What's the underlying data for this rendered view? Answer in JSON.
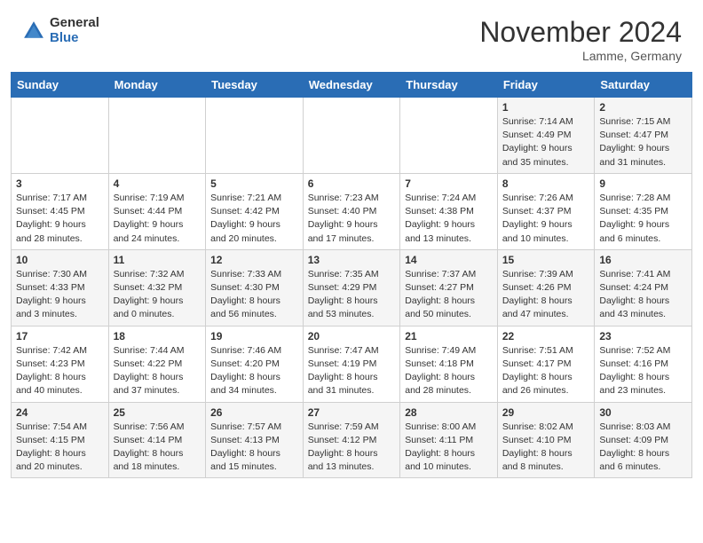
{
  "header": {
    "logo": {
      "general": "General",
      "blue": "Blue"
    },
    "title": "November 2024",
    "subtitle": "Lamme, Germany"
  },
  "calendar": {
    "days": [
      "Sunday",
      "Monday",
      "Tuesday",
      "Wednesday",
      "Thursday",
      "Friday",
      "Saturday"
    ],
    "weeks": [
      [
        {
          "day": "",
          "info": ""
        },
        {
          "day": "",
          "info": ""
        },
        {
          "day": "",
          "info": ""
        },
        {
          "day": "",
          "info": ""
        },
        {
          "day": "",
          "info": ""
        },
        {
          "day": "1",
          "info": "Sunrise: 7:14 AM\nSunset: 4:49 PM\nDaylight: 9 hours\nand 35 minutes."
        },
        {
          "day": "2",
          "info": "Sunrise: 7:15 AM\nSunset: 4:47 PM\nDaylight: 9 hours\nand 31 minutes."
        }
      ],
      [
        {
          "day": "3",
          "info": "Sunrise: 7:17 AM\nSunset: 4:45 PM\nDaylight: 9 hours\nand 28 minutes."
        },
        {
          "day": "4",
          "info": "Sunrise: 7:19 AM\nSunset: 4:44 PM\nDaylight: 9 hours\nand 24 minutes."
        },
        {
          "day": "5",
          "info": "Sunrise: 7:21 AM\nSunset: 4:42 PM\nDaylight: 9 hours\nand 20 minutes."
        },
        {
          "day": "6",
          "info": "Sunrise: 7:23 AM\nSunset: 4:40 PM\nDaylight: 9 hours\nand 17 minutes."
        },
        {
          "day": "7",
          "info": "Sunrise: 7:24 AM\nSunset: 4:38 PM\nDaylight: 9 hours\nand 13 minutes."
        },
        {
          "day": "8",
          "info": "Sunrise: 7:26 AM\nSunset: 4:37 PM\nDaylight: 9 hours\nand 10 minutes."
        },
        {
          "day": "9",
          "info": "Sunrise: 7:28 AM\nSunset: 4:35 PM\nDaylight: 9 hours\nand 6 minutes."
        }
      ],
      [
        {
          "day": "10",
          "info": "Sunrise: 7:30 AM\nSunset: 4:33 PM\nDaylight: 9 hours\nand 3 minutes."
        },
        {
          "day": "11",
          "info": "Sunrise: 7:32 AM\nSunset: 4:32 PM\nDaylight: 9 hours\nand 0 minutes."
        },
        {
          "day": "12",
          "info": "Sunrise: 7:33 AM\nSunset: 4:30 PM\nDaylight: 8 hours\nand 56 minutes."
        },
        {
          "day": "13",
          "info": "Sunrise: 7:35 AM\nSunset: 4:29 PM\nDaylight: 8 hours\nand 53 minutes."
        },
        {
          "day": "14",
          "info": "Sunrise: 7:37 AM\nSunset: 4:27 PM\nDaylight: 8 hours\nand 50 minutes."
        },
        {
          "day": "15",
          "info": "Sunrise: 7:39 AM\nSunset: 4:26 PM\nDaylight: 8 hours\nand 47 minutes."
        },
        {
          "day": "16",
          "info": "Sunrise: 7:41 AM\nSunset: 4:24 PM\nDaylight: 8 hours\nand 43 minutes."
        }
      ],
      [
        {
          "day": "17",
          "info": "Sunrise: 7:42 AM\nSunset: 4:23 PM\nDaylight: 8 hours\nand 40 minutes."
        },
        {
          "day": "18",
          "info": "Sunrise: 7:44 AM\nSunset: 4:22 PM\nDaylight: 8 hours\nand 37 minutes."
        },
        {
          "day": "19",
          "info": "Sunrise: 7:46 AM\nSunset: 4:20 PM\nDaylight: 8 hours\nand 34 minutes."
        },
        {
          "day": "20",
          "info": "Sunrise: 7:47 AM\nSunset: 4:19 PM\nDaylight: 8 hours\nand 31 minutes."
        },
        {
          "day": "21",
          "info": "Sunrise: 7:49 AM\nSunset: 4:18 PM\nDaylight: 8 hours\nand 28 minutes."
        },
        {
          "day": "22",
          "info": "Sunrise: 7:51 AM\nSunset: 4:17 PM\nDaylight: 8 hours\nand 26 minutes."
        },
        {
          "day": "23",
          "info": "Sunrise: 7:52 AM\nSunset: 4:16 PM\nDaylight: 8 hours\nand 23 minutes."
        }
      ],
      [
        {
          "day": "24",
          "info": "Sunrise: 7:54 AM\nSunset: 4:15 PM\nDaylight: 8 hours\nand 20 minutes."
        },
        {
          "day": "25",
          "info": "Sunrise: 7:56 AM\nSunset: 4:14 PM\nDaylight: 8 hours\nand 18 minutes."
        },
        {
          "day": "26",
          "info": "Sunrise: 7:57 AM\nSunset: 4:13 PM\nDaylight: 8 hours\nand 15 minutes."
        },
        {
          "day": "27",
          "info": "Sunrise: 7:59 AM\nSunset: 4:12 PM\nDaylight: 8 hours\nand 13 minutes."
        },
        {
          "day": "28",
          "info": "Sunrise: 8:00 AM\nSunset: 4:11 PM\nDaylight: 8 hours\nand 10 minutes."
        },
        {
          "day": "29",
          "info": "Sunrise: 8:02 AM\nSunset: 4:10 PM\nDaylight: 8 hours\nand 8 minutes."
        },
        {
          "day": "30",
          "info": "Sunrise: 8:03 AM\nSunset: 4:09 PM\nDaylight: 8 hours\nand 6 minutes."
        }
      ]
    ]
  }
}
